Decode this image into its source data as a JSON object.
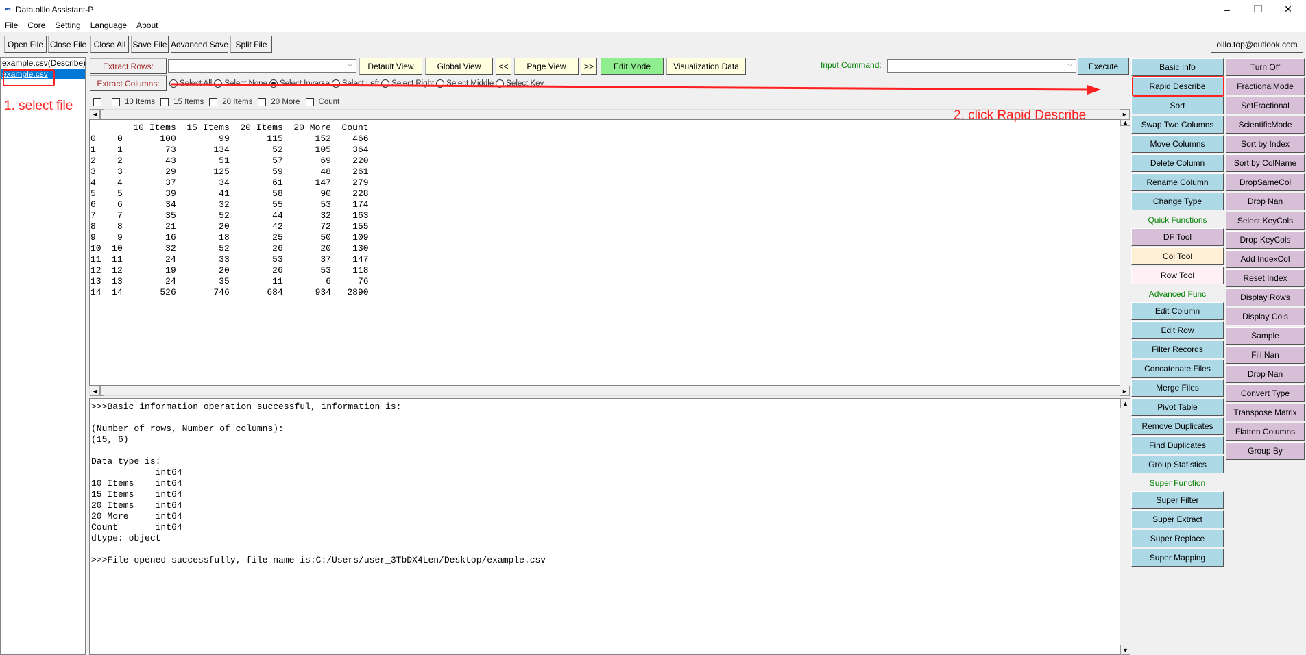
{
  "window": {
    "title": "Data.olllo Assistant-P",
    "minimize": "–",
    "restore": "❐",
    "close": "✕"
  },
  "menu": [
    "File",
    "Core",
    "Setting",
    "Language",
    "About"
  ],
  "toolbar": [
    "Open File",
    "Close File",
    "Close All",
    "Save File",
    "Advanced Save",
    "Split File"
  ],
  "contact": "olllo.top@outlook.com",
  "files": [
    {
      "name": "example.csv(Describe)",
      "selected": false
    },
    {
      "name": "example.csv",
      "selected": true
    }
  ],
  "extract": {
    "rows_label": "Extract Rows:",
    "cols_label": "Extract Columns:",
    "rows_value": ""
  },
  "views": {
    "default": "Default View",
    "global": "Global View",
    "prev": "<<",
    "page": "Page View",
    "next": ">>",
    "edit": "Edit Mode",
    "vis": "Visualization Data"
  },
  "command": {
    "label": "Input Command:",
    "value": "",
    "execute": "Execute"
  },
  "radios": [
    {
      "label": "Select All",
      "checked": false
    },
    {
      "label": "Select None",
      "checked": false
    },
    {
      "label": "Select Inverse",
      "checked": true
    },
    {
      "label": "Select Left",
      "checked": false
    },
    {
      "label": "Select Right",
      "checked": false
    },
    {
      "label": "Select Middle",
      "checked": false
    },
    {
      "label": "Select Key",
      "checked": false
    }
  ],
  "checkboxes": [
    "",
    "10 Items",
    "15 Items",
    "20 Items",
    "20 More",
    "Count"
  ],
  "table": {
    "headers": [
      "",
      "",
      "10 Items",
      "15 Items",
      "20 Items",
      "20 More",
      "Count"
    ],
    "rows": [
      [
        "0",
        "0",
        "100",
        "99",
        "115",
        "152",
        "466"
      ],
      [
        "1",
        "1",
        "73",
        "134",
        "52",
        "105",
        "364"
      ],
      [
        "2",
        "2",
        "43",
        "51",
        "57",
        "69",
        "220"
      ],
      [
        "3",
        "3",
        "29",
        "125",
        "59",
        "48",
        "261"
      ],
      [
        "4",
        "4",
        "37",
        "34",
        "61",
        "147",
        "279"
      ],
      [
        "5",
        "5",
        "39",
        "41",
        "58",
        "90",
        "228"
      ],
      [
        "6",
        "6",
        "34",
        "32",
        "55",
        "53",
        "174"
      ],
      [
        "7",
        "7",
        "35",
        "52",
        "44",
        "32",
        "163"
      ],
      [
        "8",
        "8",
        "21",
        "20",
        "42",
        "72",
        "155"
      ],
      [
        "9",
        "9",
        "16",
        "18",
        "25",
        "50",
        "109"
      ],
      [
        "10",
        "10",
        "32",
        "52",
        "26",
        "20",
        "130"
      ],
      [
        "11",
        "11",
        "24",
        "33",
        "53",
        "37",
        "147"
      ],
      [
        "12",
        "12",
        "19",
        "20",
        "26",
        "53",
        "118"
      ],
      [
        "13",
        "13",
        "24",
        "35",
        "11",
        "6",
        "76"
      ],
      [
        "14",
        "14",
        "526",
        "746",
        "684",
        "934",
        "2890"
      ]
    ]
  },
  "console": [
    ">>>Basic information operation successful, information is:",
    "",
    "(Number of rows, Number of columns):",
    "(15, 6)",
    "",
    "Data type is:",
    "            int64",
    "10 Items    int64",
    "15 Items    int64",
    "20 Items    int64",
    "20 More     int64",
    "Count       int64",
    "dtype: object",
    "",
    ">>>File opened successfully, file name is:C:/Users/user_3TbDX4Len/Desktop/example.csv"
  ],
  "panel1": [
    {
      "type": "btn",
      "label": "Basic Info",
      "color": "blue"
    },
    {
      "type": "btn",
      "label": "Rapid Describe",
      "color": "blue"
    },
    {
      "type": "btn",
      "label": "Sort",
      "color": "blue"
    },
    {
      "type": "btn",
      "label": "Swap Two Columns",
      "color": "blue"
    },
    {
      "type": "btn",
      "label": "Move Columns",
      "color": "blue"
    },
    {
      "type": "btn",
      "label": "Delete Column",
      "color": "blue"
    },
    {
      "type": "btn",
      "label": "Rename Column",
      "color": "blue"
    },
    {
      "type": "btn",
      "label": "Change Type",
      "color": "blue"
    },
    {
      "type": "label",
      "label": "Quick Functions"
    },
    {
      "type": "btn",
      "label": "DF Tool",
      "color": "purple"
    },
    {
      "type": "btn",
      "label": "Col Tool",
      "color": "peach"
    },
    {
      "type": "btn",
      "label": "Row Tool",
      "color": "pink"
    },
    {
      "type": "label",
      "label": "Advanced Func"
    },
    {
      "type": "btn",
      "label": "Edit Column",
      "color": "blue"
    },
    {
      "type": "btn",
      "label": "Edit Row",
      "color": "blue"
    },
    {
      "type": "btn",
      "label": "Filter Records",
      "color": "blue"
    },
    {
      "type": "btn",
      "label": "Concatenate Files",
      "color": "blue"
    },
    {
      "type": "btn",
      "label": "Merge Files",
      "color": "blue"
    },
    {
      "type": "btn",
      "label": "Pivot Table",
      "color": "blue"
    },
    {
      "type": "btn",
      "label": "Remove Duplicates",
      "color": "blue"
    },
    {
      "type": "btn",
      "label": "Find Duplicates",
      "color": "blue"
    },
    {
      "type": "btn",
      "label": "Group Statistics",
      "color": "blue"
    },
    {
      "type": "label",
      "label": "Super Function"
    },
    {
      "type": "btn",
      "label": "Super Filter",
      "color": "blue"
    },
    {
      "type": "btn",
      "label": "Super Extract",
      "color": "blue"
    },
    {
      "type": "btn",
      "label": "Super Replace",
      "color": "blue"
    },
    {
      "type": "btn",
      "label": "Super Mapping",
      "color": "blue"
    }
  ],
  "panel2": [
    "Turn Off",
    "FractionalMode",
    "SetFractional",
    "ScientificMode",
    "Sort by Index",
    "Sort by ColName",
    "DropSameCol",
    "Drop Nan",
    "Select KeyCols",
    "Drop KeyCols",
    "Add IndexCol",
    "Reset Index",
    "Display Rows",
    "Display Cols",
    "Sample",
    "Fill Nan",
    "Drop Nan",
    "Convert Type",
    "Transpose Matrix",
    "Flatten Columns",
    "Group By"
  ],
  "annotations": {
    "step1": "1. select file",
    "step2": "2. click Rapid Describe",
    "color": "#ff2020"
  },
  "colors": {
    "blue": "#add8e6",
    "purple": "#d8bfd8",
    "peach": "#ffefd5",
    "pink": "#fff0f5",
    "view": "#ffffe0",
    "edit_mode": "#90ee90",
    "selection": "#0078d7"
  }
}
